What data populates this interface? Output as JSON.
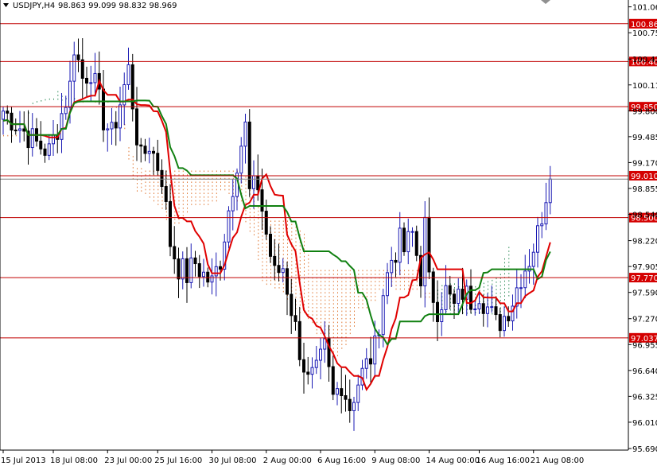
{
  "header": {
    "symbol": "USDJPY,H4",
    "ohlc": "98.863 99.099 98.832 98.969"
  },
  "colors": {
    "background": "#ffffff",
    "candle_up": "#1a1ab4",
    "candle_down": "#000000",
    "tenkan": "#e00000",
    "kijun": "#108010",
    "cloud_bull": "#2e8b57",
    "cloud_bear": "#e07b39",
    "level_line": "#c00000",
    "level_tag": "#d40000",
    "current_price_line": "#808080",
    "axis": "#000000"
  },
  "icons": {
    "menu": "triangle-down-icon",
    "scroll": "diamond-icon"
  },
  "chart_data": {
    "type": "candlestick",
    "title": "USDJPY,H4",
    "ylim": [
      95.69,
      101.1
    ],
    "y_ticks": [
      "101.065",
      "100.750",
      "100.430",
      "100.115",
      "99.800",
      "99.485",
      "99.170",
      "98.855",
      "98.540",
      "98.220",
      "97.905",
      "97.590",
      "97.270",
      "96.955",
      "96.640",
      "96.325",
      "96.010",
      "95.690"
    ],
    "x_ticks": [
      "15 Jul 2013",
      "18 Jul 08:00",
      "23 Jul 00:00",
      "25 Jul 16:00",
      "30 Jul 08:00",
      "2 Aug 00:00",
      "6 Aug 16:00",
      "9 Aug 08:00",
      "14 Aug 00:00",
      "16 Aug 16:00",
      "21 Aug 08:00"
    ],
    "levels": [
      "100.860",
      "100.400",
      "99.850",
      "99.010",
      "98.500",
      "97.770",
      "97.037"
    ],
    "current_price": 98.969,
    "grid": false,
    "indicators": [
      "tenkan-sen",
      "kijun-sen",
      "ichimoku cloud"
    ],
    "close_path": [
      [
        0,
        99.8
      ],
      [
        4,
        99.6
      ],
      [
        8,
        99.4
      ],
      [
        11,
        99.3
      ],
      [
        13,
        99.6
      ],
      [
        16,
        100.1
      ],
      [
        17,
        100.6
      ],
      [
        19,
        100.2
      ],
      [
        21,
        100.3
      ],
      [
        24,
        99.7
      ],
      [
        26,
        99.5
      ],
      [
        28,
        99.9
      ],
      [
        30,
        100.3
      ],
      [
        32,
        99.5
      ],
      [
        33,
        99.2
      ],
      [
        35,
        99.4
      ],
      [
        38,
        99.0
      ],
      [
        40,
        98.2
      ],
      [
        42,
        97.9
      ],
      [
        44,
        97.8
      ],
      [
        46,
        97.95
      ],
      [
        48,
        97.8
      ],
      [
        50,
        97.7
      ],
      [
        52,
        98.0
      ],
      [
        54,
        98.6
      ],
      [
        56,
        99.2
      ],
      [
        58,
        99.6
      ],
      [
        59,
        98.8
      ],
      [
        61,
        98.9
      ],
      [
        63,
        98.3
      ],
      [
        65,
        97.8
      ],
      [
        67,
        97.9
      ],
      [
        69,
        97.4
      ],
      [
        71,
        96.9
      ],
      [
        73,
        96.5
      ],
      [
        75,
        96.6
      ],
      [
        77,
        96.9
      ],
      [
        79,
        96.3
      ],
      [
        81,
        96.5
      ],
      [
        83,
        96.2
      ],
      [
        85,
        96.5
      ],
      [
        87,
        96.7
      ],
      [
        89,
        96.9
      ],
      [
        91,
        97.6
      ],
      [
        93,
        98.0
      ],
      [
        95,
        98.2
      ],
      [
        96,
        98.1
      ],
      [
        98,
        98.3
      ],
      [
        100,
        97.8
      ],
      [
        101,
        98.4
      ],
      [
        102,
        97.7
      ],
      [
        104,
        97.4
      ],
      [
        106,
        97.6
      ],
      [
        108,
        97.4
      ],
      [
        110,
        97.6
      ],
      [
        112,
        97.5
      ],
      [
        114,
        97.6
      ],
      [
        116,
        97.4
      ],
      [
        118,
        97.2
      ],
      [
        120,
        97.3
      ],
      [
        122,
        97.5
      ],
      [
        124,
        97.8
      ],
      [
        126,
        98.0
      ],
      [
        128,
        98.3
      ],
      [
        130,
        98.8
      ],
      [
        131,
        98.969
      ]
    ]
  }
}
